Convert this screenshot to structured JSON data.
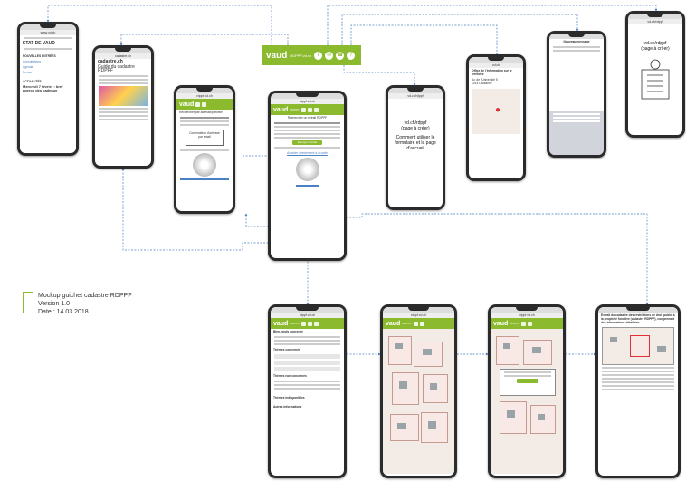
{
  "legend": {
    "title": "Mockup guichet cadastre RDPPF",
    "version": "Version 1.0",
    "date": "Date : 14.03.2018"
  },
  "toolbar": {
    "logo": "vaud",
    "brand": "RDPPF.vd.ch",
    "help": "?"
  },
  "phones": {
    "etat": {
      "url": "www.vd.ch",
      "title": "ETAT DE VAUD",
      "news_heading": "NOUVELLES ENTRÉES",
      "news_items": [
        "Consultations",
        "Agenda",
        "Presse"
      ],
      "actu_heading": "ACTUALITÉS",
      "actu_text": "Mercredi 7 février : bref aperçu des cadeaux"
    },
    "cadastre": {
      "url": "cadastre.ch",
      "title": "cadastre.ch",
      "guide": "Guide du cadastre RDPPF"
    },
    "home_small": {
      "url": "rdppf.vd.ch",
      "search_label": "Rechercher par adresse/parcelle",
      "popup": "Confirmation d'adresse par email"
    },
    "home_main": {
      "url": "rdppf.vd.ch",
      "search_label": "Rechercher un extrait RDPPF",
      "link": "Accéder directement à la carte",
      "btn": "Envoyer l'extrait"
    },
    "help": {
      "url": "vd.ch/rdppf",
      "title": "vd.ch/rdppf\n(page à créer)",
      "body": "Comment utiliser le formulaire et la page d'accueil"
    },
    "contact": {
      "url": "vd.ch",
      "title": "Office de l'information sur le territoire",
      "address": "Av. de l'Université 5\n1014 Lausanne"
    },
    "mail": {
      "title": "Nouveau message"
    },
    "faq": {
      "url": "vd.ch/rdppf",
      "title": "vd.ch/rdppf\n(page à créer)"
    },
    "themes": {
      "url": "rdppf.vd.ch",
      "heading": "Bien-fonds concerné",
      "concerned": "Thèmes concernés",
      "not_concerned": "Thèmes non concernés",
      "not_available": "Thèmes indisponibles",
      "other": "Autres informations"
    },
    "map1": {
      "url": "rdppf.vd.ch"
    },
    "map2": {
      "url": "rdppf.vd.ch"
    },
    "extract": {
      "title": "Extrait du cadastre des restrictions de droit public à la propriété foncière (cadastre RDPPF), comprenant des informations détaillées"
    }
  }
}
